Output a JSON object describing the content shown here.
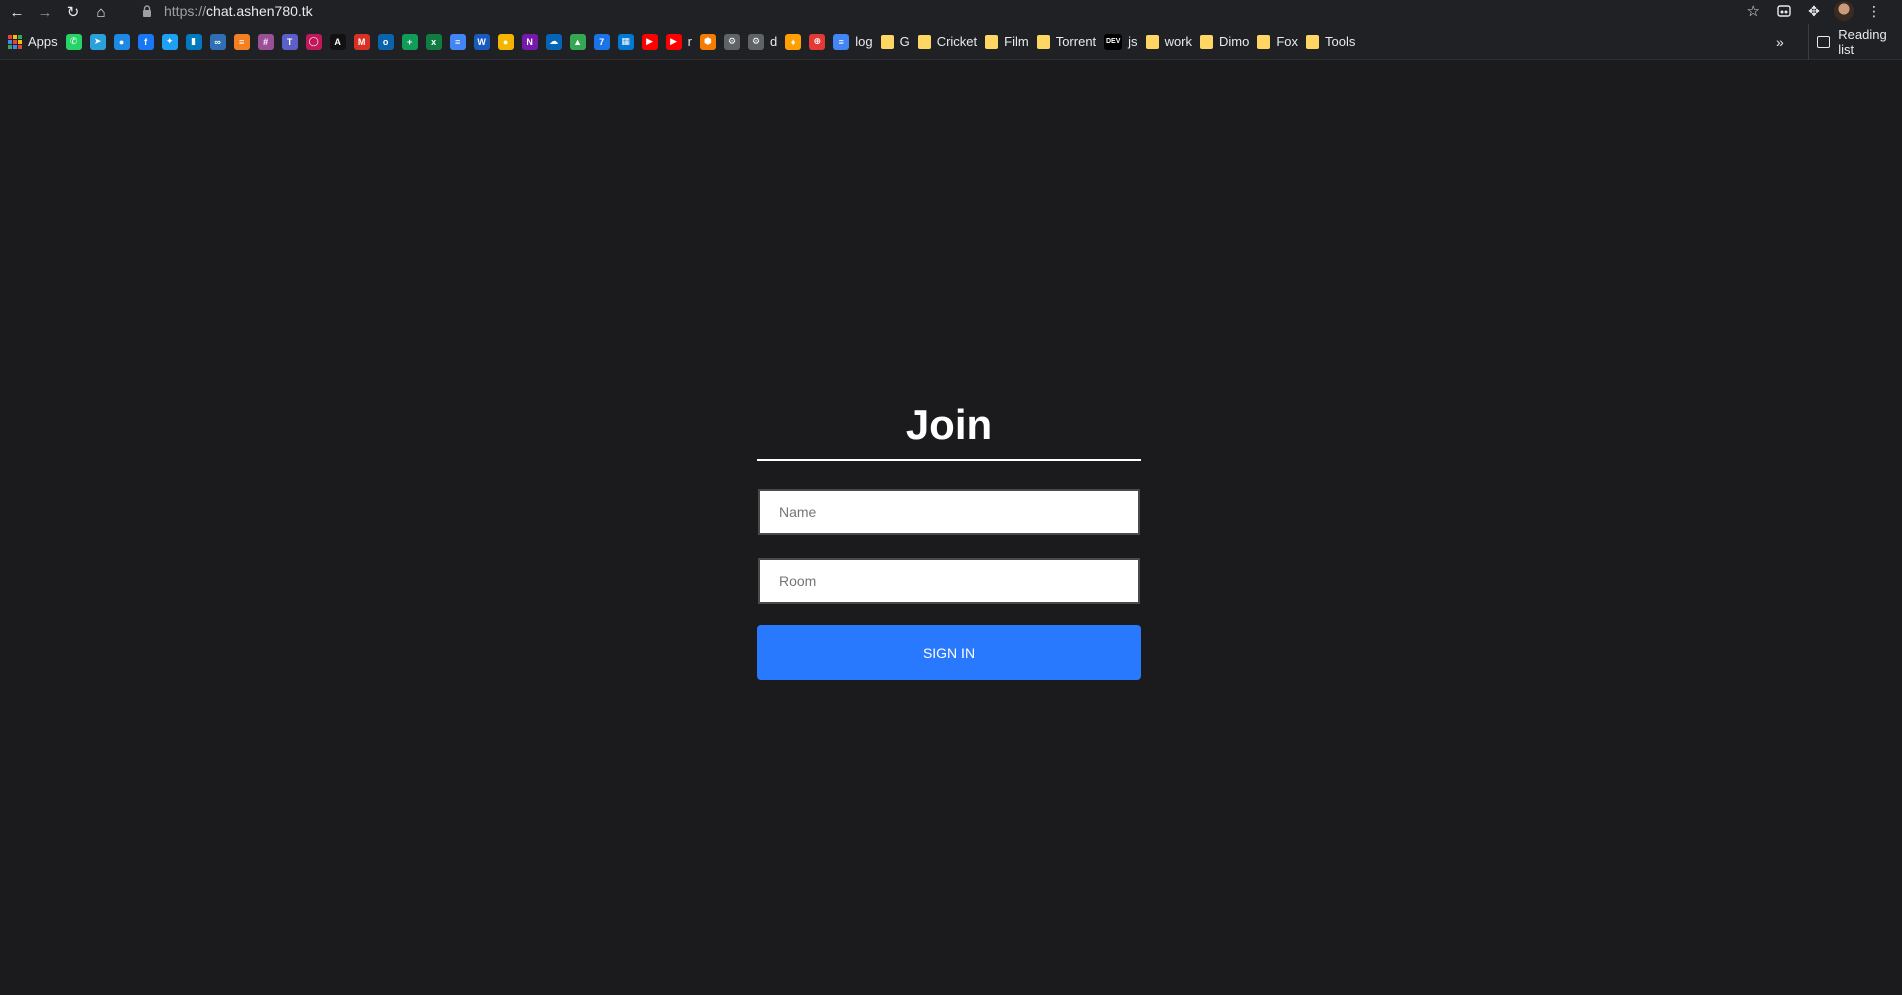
{
  "browser": {
    "url_scheme": "https://",
    "url_host": "chat.ashen780.tk",
    "icons": [
      "back-icon",
      "forward-icon",
      "reload-icon",
      "home-icon",
      "lock-icon",
      "star-icon",
      "extension-icon",
      "puzzle-icon",
      "menu-icon"
    ]
  },
  "bookmarks": {
    "apps_label": "Apps",
    "items": [
      {
        "name": "whatsapp",
        "label": "",
        "color": "#25d366",
        "glyph": "✆"
      },
      {
        "name": "telegram",
        "label": "",
        "color": "#2aa1da",
        "glyph": "➤"
      },
      {
        "name": "messenger",
        "label": "",
        "color": "#1e88e5",
        "glyph": "●"
      },
      {
        "name": "facebook",
        "label": "",
        "color": "#1877f2",
        "glyph": "f"
      },
      {
        "name": "twitter",
        "label": "",
        "color": "#1da1f2",
        "glyph": "✦"
      },
      {
        "name": "trello",
        "label": "",
        "color": "#0079bf",
        "glyph": "▮"
      },
      {
        "name": "link",
        "label": "",
        "color": "#2f6fb5",
        "glyph": "∞"
      },
      {
        "name": "stackoverflow",
        "label": "",
        "color": "#f48024",
        "glyph": "≡"
      },
      {
        "name": "slack",
        "label": "",
        "color": "#9b4f96",
        "glyph": "#"
      },
      {
        "name": "teams",
        "label": "",
        "color": "#5b5fc7",
        "glyph": "T"
      },
      {
        "name": "ring",
        "label": "",
        "color": "#c2185b",
        "glyph": "◯"
      },
      {
        "name": "cs50",
        "label": "",
        "color": "#111111",
        "glyph": "A"
      },
      {
        "name": "gmail",
        "label": "",
        "color": "#d93025",
        "glyph": "M"
      },
      {
        "name": "outlook",
        "label": "",
        "color": "#0a64ad",
        "glyph": "o"
      },
      {
        "name": "sheets",
        "label": "",
        "color": "#0f9d58",
        "glyph": "+"
      },
      {
        "name": "excel",
        "label": "",
        "color": "#107c41",
        "glyph": "x"
      },
      {
        "name": "docs",
        "label": "",
        "color": "#4285f4",
        "glyph": "≡"
      },
      {
        "name": "word",
        "label": "",
        "color": "#185abd",
        "glyph": "W"
      },
      {
        "name": "keep",
        "label": "",
        "color": "#f4b400",
        "glyph": "●"
      },
      {
        "name": "onenote",
        "label": "",
        "color": "#7719aa",
        "glyph": "N"
      },
      {
        "name": "onedrive",
        "label": "",
        "color": "#0364b8",
        "glyph": "☁"
      },
      {
        "name": "drive",
        "label": "",
        "color": "#34a853",
        "glyph": "▲"
      },
      {
        "name": "calendar",
        "label": "",
        "color": "#1a73e8",
        "glyph": "7"
      },
      {
        "name": "windows",
        "label": "",
        "color": "#0078d4",
        "glyph": "▦"
      },
      {
        "name": "youtube",
        "label": "",
        "color": "#ff0000",
        "glyph": "▶"
      },
      {
        "name": "youtube-r",
        "label": "r",
        "color": "#ff0000",
        "glyph": "▶"
      },
      {
        "name": "box",
        "label": "",
        "color": "#f57c00",
        "glyph": "⬢"
      },
      {
        "name": "settings-gear",
        "label": "",
        "color": "#5f6368",
        "glyph": "⚙"
      },
      {
        "name": "settings-d",
        "label": "d",
        "color": "#5f6368",
        "glyph": "⚙"
      },
      {
        "name": "firebase",
        "label": "",
        "color": "#ffa000",
        "glyph": "♦"
      },
      {
        "name": "github-red",
        "label": "",
        "color": "#e53935",
        "glyph": "⊕"
      },
      {
        "name": "log",
        "label": "log",
        "color": "#4285f4",
        "glyph": "≡"
      }
    ],
    "folders": [
      {
        "name": "g",
        "label": "G"
      },
      {
        "name": "cricket",
        "label": "Cricket"
      },
      {
        "name": "film",
        "label": "Film"
      },
      {
        "name": "torrent",
        "label": "Torrent"
      }
    ],
    "dev_label": "js",
    "dev_badge": "DEV",
    "folders2": [
      {
        "name": "work",
        "label": "work"
      },
      {
        "name": "dimo",
        "label": "Dimo"
      },
      {
        "name": "fox",
        "label": "Fox"
      },
      {
        "name": "tools",
        "label": "Tools"
      }
    ],
    "overflow": "»",
    "reading_list": "Reading list"
  },
  "join": {
    "title": "Join",
    "name_placeholder": "Name",
    "name_value": "",
    "room_placeholder": "Room",
    "room_value": "",
    "sign_in_label": "SIGN IN",
    "accent_color": "#2979ff",
    "background": "#1b1b1d"
  }
}
